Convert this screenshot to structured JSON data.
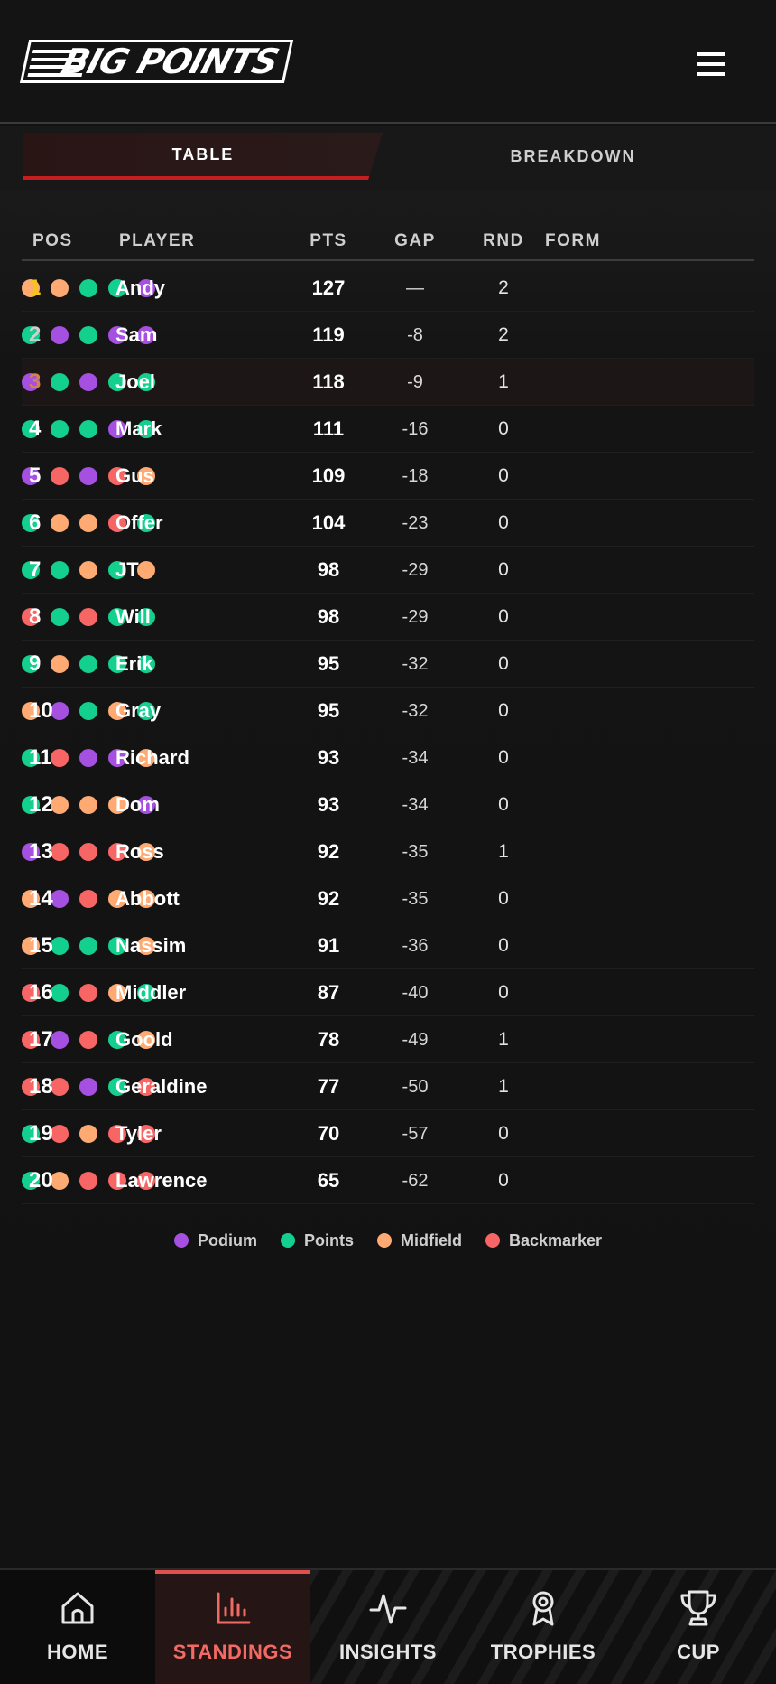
{
  "app": {
    "logo_text": "BIG POINTS"
  },
  "tabs": [
    {
      "label": "TABLE",
      "active": true
    },
    {
      "label": "BREAKDOWN",
      "active": false
    }
  ],
  "table": {
    "headers": {
      "pos": "POS",
      "player": "PLAYER",
      "pts": "PTS",
      "gap": "GAP",
      "rnd": "RND",
      "form": "FORM"
    },
    "rows": [
      {
        "pos": "1",
        "player": "Andy",
        "pts": "127",
        "gap": "—",
        "rnd": "2",
        "form": [
          "midfield",
          "midfield",
          "points",
          "points",
          "podium"
        ]
      },
      {
        "pos": "2",
        "player": "Sam",
        "pts": "119",
        "gap": "-8",
        "rnd": "2",
        "form": [
          "points",
          "podium",
          "points",
          "podium",
          "podium"
        ]
      },
      {
        "pos": "3",
        "player": "Joel",
        "pts": "118",
        "gap": "-9",
        "rnd": "1",
        "form": [
          "podium",
          "points",
          "podium",
          "points",
          "points"
        ]
      },
      {
        "pos": "4",
        "player": "Mark",
        "pts": "111",
        "gap": "-16",
        "rnd": "0",
        "form": [
          "points",
          "points",
          "points",
          "podium",
          "points"
        ]
      },
      {
        "pos": "5",
        "player": "Gus",
        "pts": "109",
        "gap": "-18",
        "rnd": "0",
        "form": [
          "podium",
          "backmarker",
          "podium",
          "backmarker",
          "midfield"
        ]
      },
      {
        "pos": "6",
        "player": "Offer",
        "pts": "104",
        "gap": "-23",
        "rnd": "0",
        "form": [
          "points",
          "midfield",
          "midfield",
          "backmarker",
          "points"
        ]
      },
      {
        "pos": "7",
        "player": "JT",
        "pts": "98",
        "gap": "-29",
        "rnd": "0",
        "form": [
          "points",
          "points",
          "midfield",
          "points",
          "midfield"
        ]
      },
      {
        "pos": "8",
        "player": "Will",
        "pts": "98",
        "gap": "-29",
        "rnd": "0",
        "form": [
          "backmarker",
          "points",
          "backmarker",
          "points",
          "points"
        ]
      },
      {
        "pos": "9",
        "player": "Erik",
        "pts": "95",
        "gap": "-32",
        "rnd": "0",
        "form": [
          "points",
          "midfield",
          "points",
          "points",
          "points"
        ]
      },
      {
        "pos": "10",
        "player": "Gray",
        "pts": "95",
        "gap": "-32",
        "rnd": "0",
        "form": [
          "midfield",
          "podium",
          "points",
          "midfield",
          "points"
        ]
      },
      {
        "pos": "11",
        "player": "Richard",
        "pts": "93",
        "gap": "-34",
        "rnd": "0",
        "form": [
          "points",
          "backmarker",
          "podium",
          "podium",
          "midfield"
        ]
      },
      {
        "pos": "12",
        "player": "Dom",
        "pts": "93",
        "gap": "-34",
        "rnd": "0",
        "form": [
          "points",
          "midfield",
          "midfield",
          "midfield",
          "podium"
        ]
      },
      {
        "pos": "13",
        "player": "Ross",
        "pts": "92",
        "gap": "-35",
        "rnd": "1",
        "form": [
          "podium",
          "backmarker",
          "backmarker",
          "backmarker",
          "midfield"
        ]
      },
      {
        "pos": "14",
        "player": "Abbott",
        "pts": "92",
        "gap": "-35",
        "rnd": "0",
        "form": [
          "midfield",
          "podium",
          "backmarker",
          "midfield",
          "midfield"
        ]
      },
      {
        "pos": "15",
        "player": "Nassim",
        "pts": "91",
        "gap": "-36",
        "rnd": "0",
        "form": [
          "midfield",
          "points",
          "points",
          "points",
          "midfield"
        ]
      },
      {
        "pos": "16",
        "player": "Middler",
        "pts": "87",
        "gap": "-40",
        "rnd": "0",
        "form": [
          "backmarker",
          "points",
          "backmarker",
          "midfield",
          "points"
        ]
      },
      {
        "pos": "17",
        "player": "Goold",
        "pts": "78",
        "gap": "-49",
        "rnd": "1",
        "form": [
          "backmarker",
          "podium",
          "backmarker",
          "points",
          "midfield"
        ]
      },
      {
        "pos": "18",
        "player": "Geraldine",
        "pts": "77",
        "gap": "-50",
        "rnd": "1",
        "form": [
          "backmarker",
          "backmarker",
          "podium",
          "points",
          "backmarker"
        ]
      },
      {
        "pos": "19",
        "player": "Tyler",
        "pts": "70",
        "gap": "-57",
        "rnd": "0",
        "form": [
          "points",
          "backmarker",
          "midfield",
          "backmarker",
          "backmarker"
        ]
      },
      {
        "pos": "20",
        "player": "Lawrence",
        "pts": "65",
        "gap": "-62",
        "rnd": "0",
        "form": [
          "points",
          "midfield",
          "backmarker",
          "backmarker",
          "backmarker"
        ]
      }
    ]
  },
  "legend": [
    {
      "key": "podium",
      "label": "Podium"
    },
    {
      "key": "points",
      "label": "Points"
    },
    {
      "key": "midfield",
      "label": "Midfield"
    },
    {
      "key": "backmarker",
      "label": "Backmarker"
    }
  ],
  "colors": {
    "podium": "#a550e0",
    "points": "#14d08f",
    "midfield": "#ffaa72",
    "backmarker": "#f76565",
    "pos1": "#f5c518",
    "pos2": "#cfcfcf",
    "pos3": "#d6824a",
    "accent": "#e0504f"
  },
  "nav": [
    {
      "label": "HOME",
      "icon": "home-icon",
      "active": false
    },
    {
      "label": "STANDINGS",
      "icon": "bar-chart-icon",
      "active": true
    },
    {
      "label": "INSIGHTS",
      "icon": "pulse-icon",
      "active": false
    },
    {
      "label": "TROPHIES",
      "icon": "medal-icon",
      "active": false
    },
    {
      "label": "CUP",
      "icon": "trophy-icon",
      "active": false
    }
  ]
}
